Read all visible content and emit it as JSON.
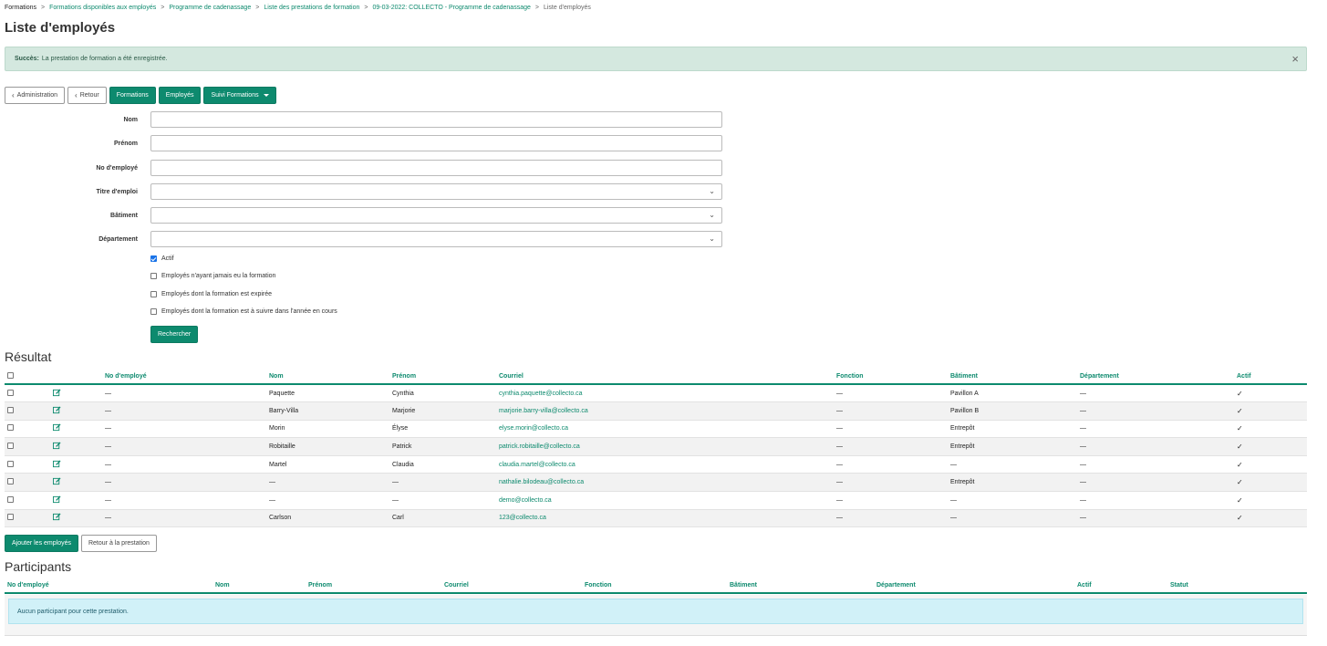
{
  "breadcrumb": [
    {
      "label": "Formations",
      "type": "static"
    },
    {
      "label": "Formations disponibles aux employés",
      "type": "link"
    },
    {
      "label": "Programme de cadenassage",
      "type": "link"
    },
    {
      "label": "Liste des prestations de formation",
      "type": "link"
    },
    {
      "label": "09-03-2022: COLLECTO - Programme de cadenassage",
      "type": "link"
    },
    {
      "label": "Liste d'employés",
      "type": "current"
    }
  ],
  "breadcrumb_separator": ">",
  "page_title": "Liste d'employés",
  "alert": {
    "prefix": "Succès:",
    "message": "La prestation de formation a été enregistrée.",
    "close": "×"
  },
  "toolbar": {
    "administration": "Administration",
    "retour": "Retour",
    "formations": "Formations",
    "employes": "Employés",
    "suivi": "Suivi Formations"
  },
  "filters": {
    "nom": "Nom",
    "prenom": "Prénom",
    "no_employe": "No d'employé",
    "titre_emploi": "Titre d'emploi",
    "batiment": "Bâtiment",
    "departement": "Département"
  },
  "checks": {
    "actif": {
      "label": "Actif",
      "checked": true
    },
    "jamais": {
      "label": "Employés n'ayant jamais eu la formation",
      "checked": false
    },
    "expiree": {
      "label": "Employés dont la formation est expirée",
      "checked": false
    },
    "annee": {
      "label": "Employés dont la formation est à suivre dans l'année en cours",
      "checked": false
    }
  },
  "search_button": "Rechercher",
  "results": {
    "title": "Résultat",
    "columns": [
      "No d'employé",
      "Nom",
      "Prénom",
      "Courriel",
      "Fonction",
      "Bâtiment",
      "Département",
      "Actif"
    ],
    "rows": [
      {
        "no": "—",
        "nom": "Paquette",
        "prenom": "Cynthia",
        "courriel": "cynthia.paquette@collecto.ca",
        "fonction": "—",
        "batiment": "Pavillon A",
        "departement": "—",
        "actif": "✓"
      },
      {
        "no": "—",
        "nom": "Barry-Villa",
        "prenom": "Marjorie",
        "courriel": "marjorie.barry-villa@collecto.ca",
        "fonction": "—",
        "batiment": "Pavillon B",
        "departement": "—",
        "actif": "✓"
      },
      {
        "no": "—",
        "nom": "Morin",
        "prenom": "Élyse",
        "courriel": "elyse.morin@collecto.ca",
        "fonction": "—",
        "batiment": "Entrepôt",
        "departement": "—",
        "actif": "✓"
      },
      {
        "no": "—",
        "nom": "Robitaille",
        "prenom": "Patrick",
        "courriel": "patrick.robitaille@collecto.ca",
        "fonction": "—",
        "batiment": "Entrepôt",
        "departement": "—",
        "actif": "✓"
      },
      {
        "no": "—",
        "nom": "Martel",
        "prenom": "Claudia",
        "courriel": "claudia.martel@collecto.ca",
        "fonction": "—",
        "batiment": "—",
        "departement": "—",
        "actif": "✓"
      },
      {
        "no": "—",
        "nom": "—",
        "prenom": "—",
        "courriel": "nathalie.bilodeau@collecto.ca",
        "fonction": "—",
        "batiment": "Entrepôt",
        "departement": "—",
        "actif": "✓"
      },
      {
        "no": "—",
        "nom": "—",
        "prenom": "—",
        "courriel": "demo@collecto.ca",
        "fonction": "—",
        "batiment": "—",
        "departement": "—",
        "actif": "✓"
      },
      {
        "no": "—",
        "nom": "Carlson",
        "prenom": "Carl",
        "courriel": "123@collecto.ca",
        "fonction": "—",
        "batiment": "—",
        "departement": "—",
        "actif": "✓"
      }
    ]
  },
  "add_button": "Ajouter les employés",
  "back_button": "Retour à la prestation",
  "participants": {
    "title": "Participants",
    "columns": [
      "No d'employé",
      "Nom",
      "Prénom",
      "Courriel",
      "Fonction",
      "Bâtiment",
      "Département",
      "Actif",
      "Statut"
    ],
    "empty": "Aucun participant pour cette prestation."
  },
  "colors": {
    "accent": "#0d8a6e",
    "alert_bg": "#d4e8df",
    "info_bg": "#d1f1f8"
  }
}
